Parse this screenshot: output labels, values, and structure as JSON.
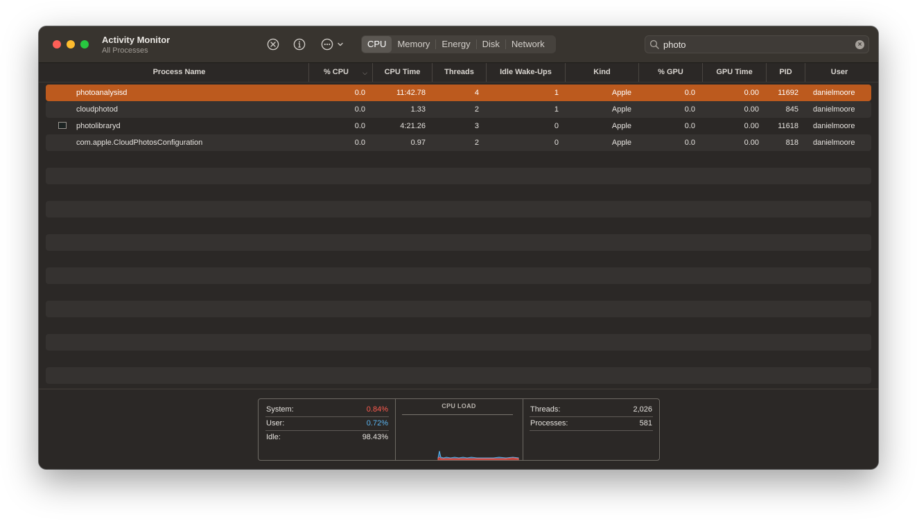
{
  "app": {
    "title": "Activity Monitor",
    "subtitle": "All Processes"
  },
  "toolbar": {
    "icons": [
      "stop-process-icon",
      "info-icon",
      "more-actions-icon"
    ],
    "tabs": [
      {
        "label": "CPU",
        "active": true
      },
      {
        "label": "Memory",
        "active": false
      },
      {
        "label": "Energy",
        "active": false
      },
      {
        "label": "Disk",
        "active": false
      },
      {
        "label": "Network",
        "active": false
      }
    ]
  },
  "search": {
    "value": "photo"
  },
  "columns": [
    "Process Name",
    "% CPU",
    "CPU Time",
    "Threads",
    "Idle Wake-Ups",
    "Kind",
    "% GPU",
    "GPU Time",
    "PID",
    "User"
  ],
  "rows": [
    {
      "name": "photoanalysisd",
      "cpu": "0.0",
      "cpu_time": "11:42.78",
      "threads": "4",
      "idle_wakeups": "1",
      "kind": "Apple",
      "gpu": "0.0",
      "gpu_time": "0.00",
      "pid": "11692",
      "user": "danielmoore",
      "selected": true,
      "icon": ""
    },
    {
      "name": "cloudphotod",
      "cpu": "0.0",
      "cpu_time": "1.33",
      "threads": "2",
      "idle_wakeups": "1",
      "kind": "Apple",
      "gpu": "0.0",
      "gpu_time": "0.00",
      "pid": "845",
      "user": "danielmoore",
      "selected": false,
      "icon": ""
    },
    {
      "name": "photolibraryd",
      "cpu": "0.0",
      "cpu_time": "4:21.26",
      "threads": "3",
      "idle_wakeups": "0",
      "kind": "Apple",
      "gpu": "0.0",
      "gpu_time": "0.00",
      "pid": "11618",
      "user": "danielmoore",
      "selected": false,
      "icon": "terminal-app-icon"
    },
    {
      "name": "com.apple.CloudPhotosConfiguration",
      "cpu": "0.0",
      "cpu_time": "0.97",
      "threads": "2",
      "idle_wakeups": "0",
      "kind": "Apple",
      "gpu": "0.0",
      "gpu_time": "0.00",
      "pid": "818",
      "user": "danielmoore",
      "selected": false,
      "icon": ""
    }
  ],
  "stats": {
    "system_label": "System:",
    "system_value": "0.84%",
    "user_label": "User:",
    "user_value": "0.72%",
    "idle_label": "Idle:",
    "idle_value": "98.43%",
    "cpu_load_title": "CPU LOAD",
    "threads_label": "Threads:",
    "threads_value": "2,026",
    "processes_label": "Processes:",
    "processes_value": "581"
  },
  "colors": {
    "selection": "#bc5a1e",
    "system": "#ff5b4f",
    "user": "#5ab4f0",
    "close": "#fe5f57",
    "minimize": "#febc2e",
    "zoom": "#28c840"
  }
}
